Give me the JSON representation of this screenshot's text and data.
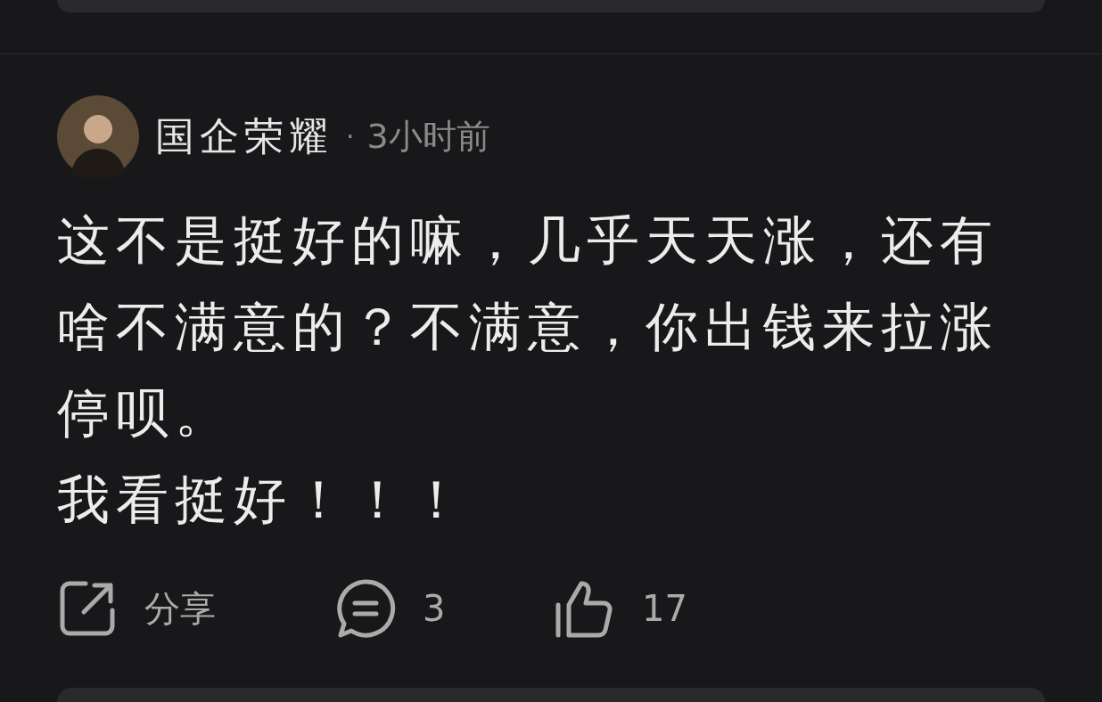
{
  "comment": {
    "author": "国企荣耀",
    "separator": "·",
    "time": "3小时前",
    "paragraphs": [
      "这不是挺好的嘛，几乎天天涨，还有啥不满意的？不满意，你出钱来拉涨停呗。",
      "我看挺好！！！"
    ],
    "actions": [
      {
        "kind": "share",
        "label": "分享"
      },
      {
        "kind": "comment",
        "label": "3"
      },
      {
        "kind": "like",
        "label": "17"
      }
    ]
  }
}
